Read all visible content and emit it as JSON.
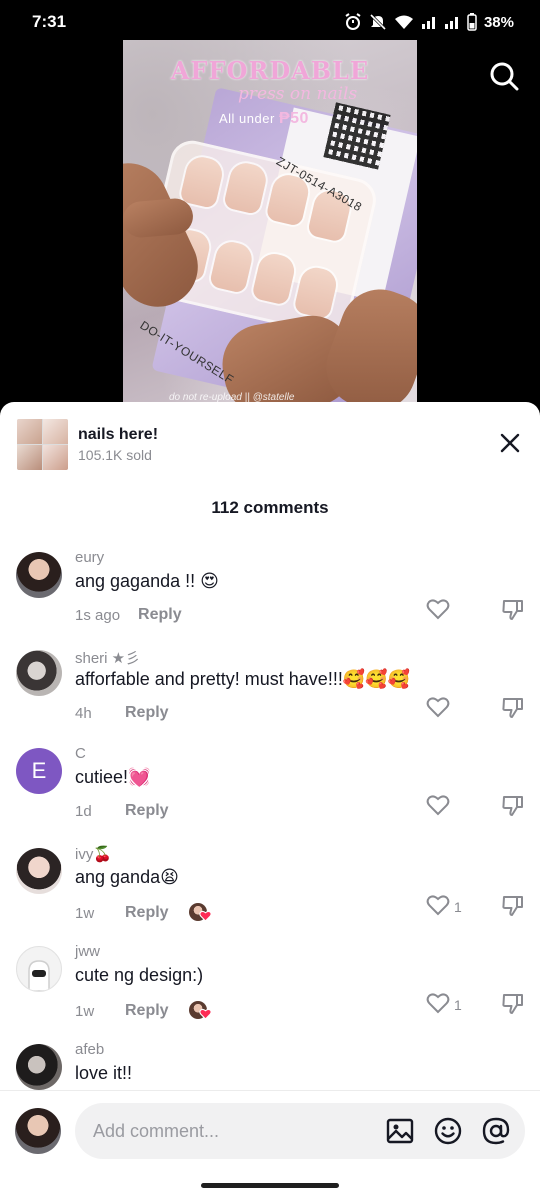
{
  "status_bar": {
    "time": "7:31",
    "battery": "38%"
  },
  "video": {
    "title": "AFFORDABLE",
    "subtitle": "press on nails",
    "price_text": "All under",
    "price_value": "₱50",
    "code": "ZJT-0514-A3018",
    "diy_text": "DO-IT-YOURSELF",
    "watermark": "do not re-upload || @statelle"
  },
  "product": {
    "name": "nails here!",
    "sold": "105.1K sold"
  },
  "comments_header": "112 comments",
  "reply_label": "Reply",
  "comments": [
    {
      "user": "eury",
      "text": "ang gaganda !! 😍",
      "time": "1s ago",
      "likes": "",
      "creator_liked": false
    },
    {
      "user": "sheri ★彡",
      "text": "afforfable and pretty! must have!!!🥰🥰🥰",
      "time": "4h",
      "likes": "",
      "creator_liked": false
    },
    {
      "user": "C",
      "avatar_letter": "E",
      "text": "cutiee!💓",
      "time": "1d",
      "likes": "",
      "creator_liked": false
    },
    {
      "user": "ivy🍒",
      "text": "ang ganda😫",
      "time": "1w",
      "likes": "1",
      "creator_liked": true
    },
    {
      "user": "jww",
      "text": "cute ng design:)",
      "time": "1w",
      "likes": "1",
      "creator_liked": true
    },
    {
      "user": "afeb",
      "text": "love it!!",
      "time": "",
      "likes": "",
      "creator_liked": false
    }
  ],
  "input": {
    "placeholder": "Add comment..."
  },
  "icons": {
    "search": "search-icon",
    "close": "close-icon",
    "like": "heart-outline-icon",
    "dislike": "thumbs-down-icon",
    "image": "image-icon",
    "emoji": "emoji-icon",
    "mention": "at-sign-icon"
  },
  "colors": {
    "text_primary": "#161823",
    "text_secondary": "#8a8b91",
    "avatar_letter_bg": "#7e57c2",
    "creator_like_heart": "#fe2c55"
  }
}
